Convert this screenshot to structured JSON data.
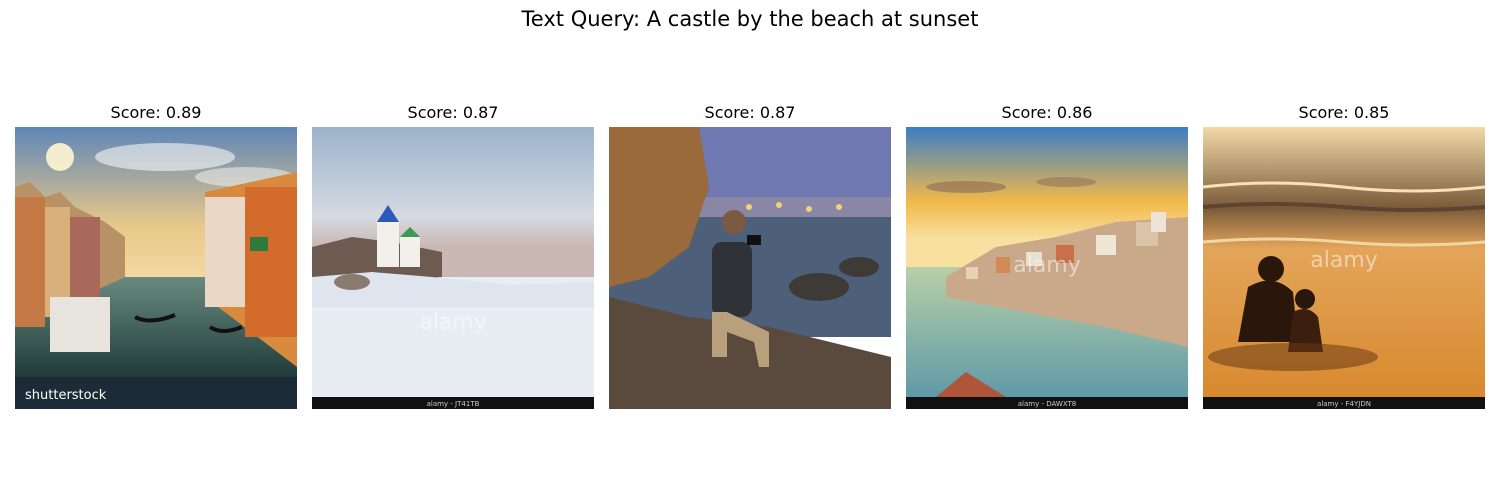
{
  "figure": {
    "title": "Text Query: A castle by the beach at sunset"
  },
  "results": [
    {
      "caption": "Score: 0.89",
      "scene_icon": "venice-canal-icon",
      "watermark_text": "shutterstock",
      "stamp_text": ""
    },
    {
      "caption": "Score: 0.87",
      "scene_icon": "snowy-church-icon",
      "watermark_text": "alamy",
      "stamp_text": "alamy - JT41TB"
    },
    {
      "caption": "Score: 0.87",
      "scene_icon": "photographer-rocky-shore-icon",
      "watermark_text": "",
      "stamp_text": ""
    },
    {
      "caption": "Score: 0.86",
      "scene_icon": "porto-river-sunset-icon",
      "watermark_text": "alamy",
      "stamp_text": "alamy - DAWXT8"
    },
    {
      "caption": "Score: 0.85",
      "scene_icon": "beach-silhouette-icon",
      "watermark_text": "alamy",
      "stamp_text": "alamy - F4YJDN"
    }
  ]
}
